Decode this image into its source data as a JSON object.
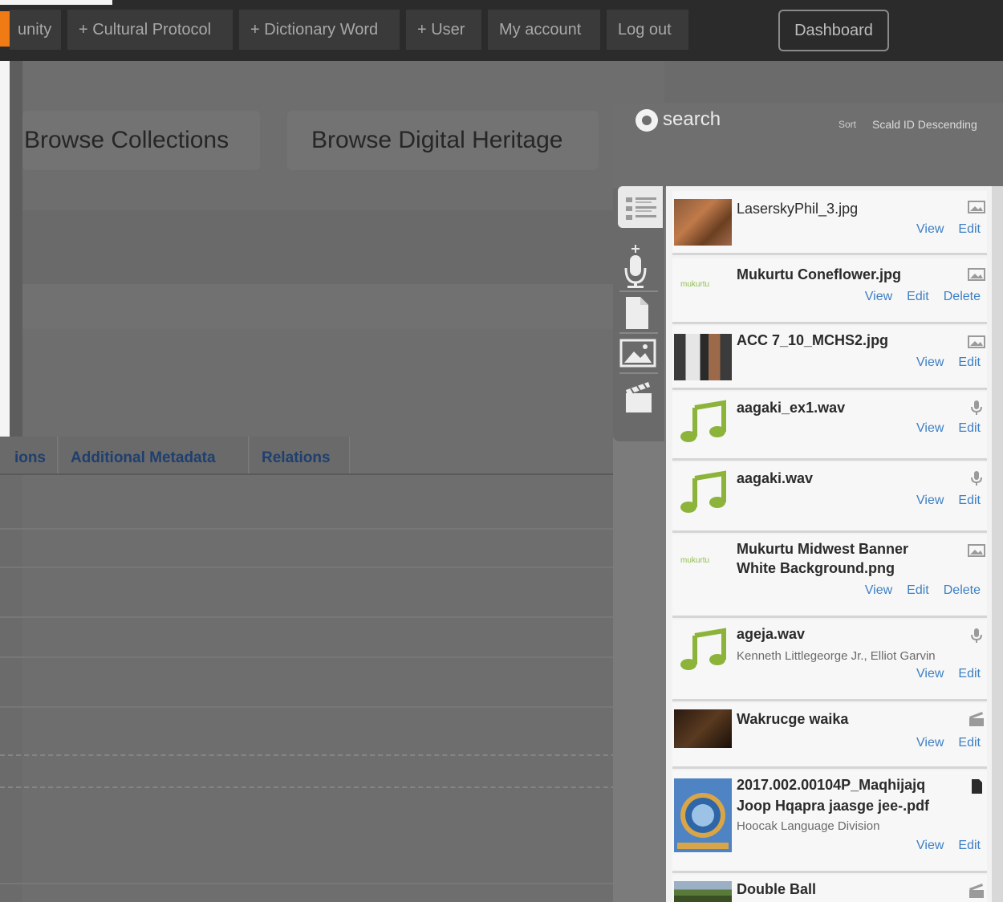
{
  "topnav": {
    "items": [
      {
        "label": "unity"
      },
      {
        "label": "+ Cultural Protocol"
      },
      {
        "label": "+ Dictionary Word"
      },
      {
        "label": "+ User"
      },
      {
        "label": "My account"
      },
      {
        "label": "Log out"
      }
    ],
    "dashboard_label": "Dashboard"
  },
  "browse": {
    "collections_label": "Browse Collections",
    "heritage_label": "Browse Digital Heritage"
  },
  "tabs": [
    {
      "label": "ions"
    },
    {
      "label": "Additional Metadata"
    },
    {
      "label": "Relations"
    }
  ],
  "search_panel": {
    "search_label": "search",
    "sort_label": "Sort",
    "sort_value": "Scald ID Descending",
    "media_types": [
      "list-icon",
      "microphone-add-icon",
      "document-icon",
      "image-icon",
      "video-clapper-icon"
    ],
    "items": [
      {
        "title": "LaserskyPhil_3.jpg",
        "subtitle": "",
        "actions": [
          "View",
          "Edit"
        ],
        "type_icon": "image-icon"
      },
      {
        "title": "Mukurtu Coneflower.jpg",
        "subtitle": "",
        "actions": [
          "View",
          "Edit",
          "Delete"
        ],
        "type_icon": "image-icon"
      },
      {
        "title": "ACC 7_10_MCHS2.jpg",
        "subtitle": "",
        "actions": [
          "View",
          "Edit"
        ],
        "type_icon": "image-icon"
      },
      {
        "title": "aagaki_ex1.wav",
        "subtitle": "",
        "actions": [
          "View",
          "Edit"
        ],
        "type_icon": "microphone-icon"
      },
      {
        "title": "aagaki.wav",
        "subtitle": "",
        "actions": [
          "View",
          "Edit"
        ],
        "type_icon": "microphone-icon"
      },
      {
        "title": "Mukurtu Midwest Banner",
        "title2": "White Background.png",
        "subtitle": "",
        "actions": [
          "View",
          "Edit",
          "Delete"
        ],
        "type_icon": "image-icon"
      },
      {
        "title": "ageja.wav",
        "subtitle": "Kenneth Littlegeorge Jr., Elliot Garvin",
        "actions": [
          "View",
          "Edit"
        ],
        "type_icon": "microphone-icon"
      },
      {
        "title": "Wakrucge waika",
        "subtitle": "",
        "actions": [
          "View",
          "Edit"
        ],
        "type_icon": "video-clapper-icon"
      },
      {
        "title": "2017.002.00104P_Maqhijajq",
        "title2": "Joop Hqapra jaasge jee-.pdf",
        "subtitle": "Hoocak Language Division",
        "actions": [
          "View",
          "Edit"
        ],
        "type_icon": "document-icon"
      },
      {
        "title": "Double Ball",
        "subtitle": "",
        "actions": [],
        "type_icon": "video-clapper-icon"
      }
    ],
    "logo_text": "mukurtu"
  }
}
